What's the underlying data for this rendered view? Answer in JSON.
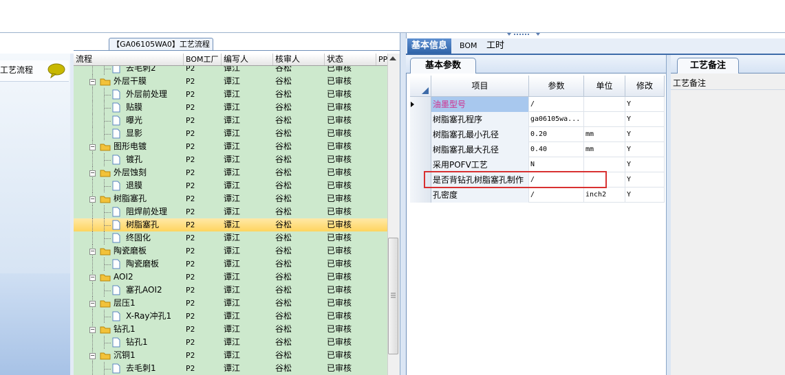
{
  "left_panel": {
    "item_label": "工艺流程"
  },
  "flow_tab": {
    "label": "【GA06105WA0】工艺流程"
  },
  "grid": {
    "headers": [
      "流程",
      "BOM工厂",
      "编写人",
      "核审人",
      "状态",
      "PP"
    ],
    "rows": [
      {
        "name": "去毛刺2",
        "level": 1,
        "type": "doc",
        "bom": "P2",
        "writer": "谭江",
        "auditor": "谷松",
        "status": "已审核"
      },
      {
        "name": "外层干膜",
        "level": 0,
        "type": "folder",
        "bom": "P2",
        "writer": "谭江",
        "auditor": "谷松",
        "status": "已审核"
      },
      {
        "name": "外层前处理",
        "level": 1,
        "type": "doc",
        "bom": "P2",
        "writer": "谭江",
        "auditor": "谷松",
        "status": "已审核"
      },
      {
        "name": "贴膜",
        "level": 1,
        "type": "doc",
        "bom": "P2",
        "writer": "谭江",
        "auditor": "谷松",
        "status": "已审核"
      },
      {
        "name": "曝光",
        "level": 1,
        "type": "doc",
        "bom": "P2",
        "writer": "谭江",
        "auditor": "谷松",
        "status": "已审核"
      },
      {
        "name": "显影",
        "level": 1,
        "type": "doc",
        "bom": "P2",
        "writer": "谭江",
        "auditor": "谷松",
        "status": "已审核"
      },
      {
        "name": "图形电镀",
        "level": 0,
        "type": "folder",
        "bom": "P2",
        "writer": "谭江",
        "auditor": "谷松",
        "status": "已审核"
      },
      {
        "name": "镀孔",
        "level": 1,
        "type": "doc",
        "bom": "P2",
        "writer": "谭江",
        "auditor": "谷松",
        "status": "已审核"
      },
      {
        "name": "外层蚀刻",
        "level": 0,
        "type": "folder",
        "bom": "P2",
        "writer": "谭江",
        "auditor": "谷松",
        "status": "已审核"
      },
      {
        "name": "退膜",
        "level": 1,
        "type": "doc",
        "bom": "P2",
        "writer": "谭江",
        "auditor": "谷松",
        "status": "已审核"
      },
      {
        "name": "树脂塞孔",
        "level": 0,
        "type": "folder",
        "bom": "P2",
        "writer": "谭江",
        "auditor": "谷松",
        "status": "已审核"
      },
      {
        "name": "阻焊前处理",
        "level": 1,
        "type": "doc",
        "bom": "P2",
        "writer": "谭江",
        "auditor": "谷松",
        "status": "已审核"
      },
      {
        "name": "树脂塞孔",
        "level": 1,
        "type": "doc",
        "bom": "P2",
        "writer": "谭江",
        "auditor": "谷松",
        "status": "已审核",
        "selected": true
      },
      {
        "name": "终固化",
        "level": 1,
        "type": "doc",
        "bom": "P2",
        "writer": "谭江",
        "auditor": "谷松",
        "status": "已审核"
      },
      {
        "name": "陶瓷磨板",
        "level": 0,
        "type": "folder",
        "bom": "P2",
        "writer": "谭江",
        "auditor": "谷松",
        "status": "已审核"
      },
      {
        "name": "陶瓷磨板",
        "level": 1,
        "type": "doc",
        "bom": "P2",
        "writer": "谭江",
        "auditor": "谷松",
        "status": "已审核"
      },
      {
        "name": "AOI2",
        "level": 0,
        "type": "folder",
        "bom": "P2",
        "writer": "谭江",
        "auditor": "谷松",
        "status": "已审核"
      },
      {
        "name": "塞孔AOI2",
        "level": 1,
        "type": "doc",
        "bom": "P2",
        "writer": "谭江",
        "auditor": "谷松",
        "status": "已审核"
      },
      {
        "name": "层压1",
        "level": 0,
        "type": "folder",
        "bom": "P2",
        "writer": "谭江",
        "auditor": "谷松",
        "status": "已审核"
      },
      {
        "name": "X-Ray冲孔1",
        "level": 1,
        "type": "doc",
        "bom": "P2",
        "writer": "谭江",
        "auditor": "谷松",
        "status": "已审核"
      },
      {
        "name": "钻孔1",
        "level": 0,
        "type": "folder",
        "bom": "P2",
        "writer": "谭江",
        "auditor": "谷松",
        "status": "已审核"
      },
      {
        "name": "钻孔1",
        "level": 1,
        "type": "doc",
        "bom": "P2",
        "writer": "谭江",
        "auditor": "谷松",
        "status": "已审核"
      },
      {
        "name": "沉铜1",
        "level": 0,
        "type": "folder",
        "bom": "P2",
        "writer": "谭江",
        "auditor": "谷松",
        "status": "已审核"
      },
      {
        "name": "去毛刺1",
        "level": 1,
        "type": "doc",
        "bom": "P2",
        "writer": "谭江",
        "auditor": "谷松",
        "status": "已审核"
      }
    ]
  },
  "tabs": [
    "基本信息",
    "BOM",
    "工时"
  ],
  "basic_params": {
    "tab_label": "基本参数",
    "headers": [
      "项目",
      "参数",
      "单位",
      "修改"
    ],
    "rows": [
      {
        "item": "油墨型号",
        "value": "/",
        "unit": "",
        "modify": "Y"
      },
      {
        "item": "树脂塞孔程序",
        "value": "ga06105wa...",
        "unit": "",
        "modify": "Y"
      },
      {
        "item": "树脂塞孔最小孔径",
        "value": "0.20",
        "unit": "mm",
        "modify": "Y"
      },
      {
        "item": "树脂塞孔最大孔径",
        "value": "0.40",
        "unit": "mm",
        "modify": "Y"
      },
      {
        "item": "采用POFV工艺",
        "value": "N",
        "unit": "",
        "modify": "Y"
      },
      {
        "item": "是否背钻孔树脂塞孔制作",
        "value": "/",
        "unit": "",
        "modify": "Y"
      },
      {
        "item": "孔密度",
        "value": "/",
        "unit": "inch2",
        "modify": "Y"
      }
    ]
  },
  "remarks": {
    "tab_label": "工艺备注",
    "field_label": "工艺备注"
  },
  "colors": {
    "grid_bg": "#cde9cd",
    "selected_row": "#ffd45e",
    "accent": "#2f63a8",
    "highlight_box": "#d83030"
  }
}
